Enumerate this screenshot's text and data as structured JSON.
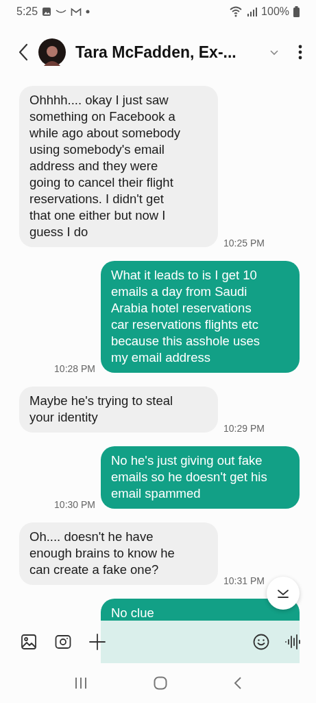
{
  "status_bar": {
    "time": "5:25",
    "battery": "100%"
  },
  "header": {
    "title": "Tara McFadden, Ex-..."
  },
  "messages": [
    {
      "kind": "received",
      "text": "Ohhhh.... okay  I just saw\nsomething on Facebook a\nwhile ago about somebody\nusing somebody's email\naddress and they were\ngoing to cancel their flight\nreservations. I didn't get\nthat one either but now I\nguess I do",
      "time": "10:25 PM"
    },
    {
      "kind": "sent",
      "text": "What it leads to is I get 10\nemails a day from Saudi\nArabia hotel reservations\ncar reservations flights etc\nbecause this asshole uses\nmy email address",
      "time": "10:28 PM"
    },
    {
      "kind": "received",
      "text": "Maybe he's trying to steal\nyour identity",
      "time": "10:29 PM"
    },
    {
      "kind": "sent",
      "text": "No he's just giving out fake\nemails so he doesn't get his\nemail spammed",
      "time": "10:30 PM"
    },
    {
      "kind": "received",
      "text": "Oh.... doesn't he have\nenough brains to know he\ncan create a fake one?",
      "time": "10:31 PM"
    },
    {
      "kind": "sent",
      "text": "No clue"
    }
  ]
}
